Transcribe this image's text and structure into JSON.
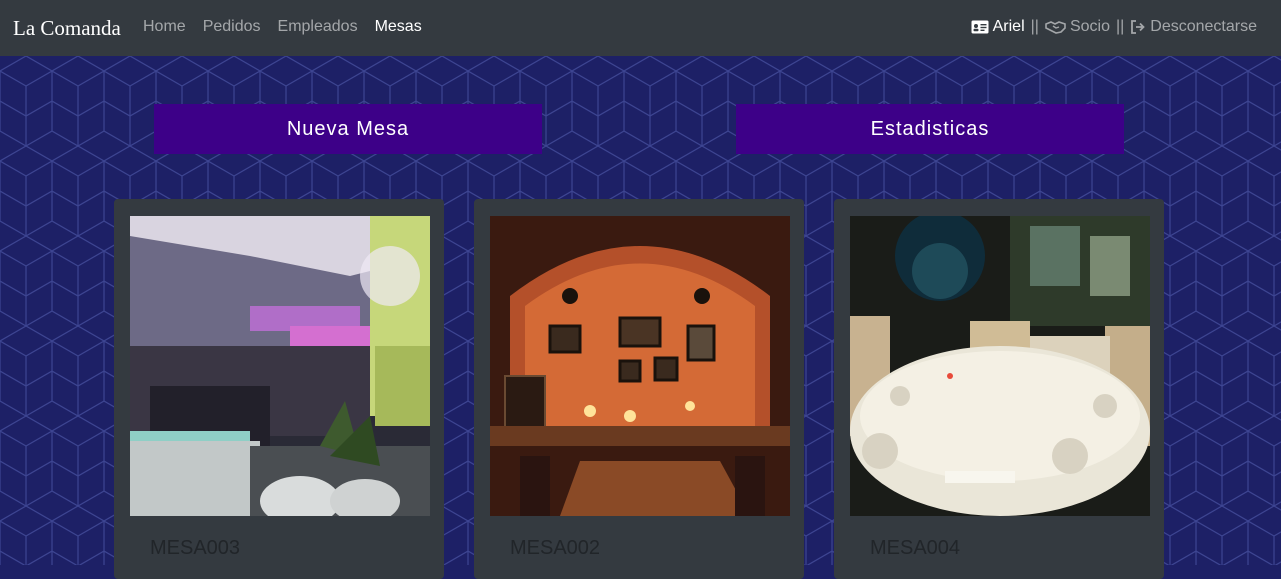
{
  "navbar": {
    "brand": "La Comanda",
    "links": [
      "Home",
      "Pedidos",
      "Empleados",
      "Mesas"
    ],
    "active": "Mesas",
    "user": "Ariel",
    "separator": "||",
    "role": "Socio",
    "logout": "Desconectarse"
  },
  "actions": {
    "new_table": "Nueva Mesa",
    "stats": "Estadisticas"
  },
  "tables": [
    {
      "code": "MESA003",
      "image": "modern lounge bar interior"
    },
    {
      "code": "MESA002",
      "image": "brick arch restaurant with candles"
    },
    {
      "code": "MESA004",
      "image": "round table with white tablecloth"
    }
  ],
  "colors": {
    "navbar": "#343a40",
    "background": "#1d2066",
    "button": "#3d0088",
    "card": "#343a40"
  }
}
